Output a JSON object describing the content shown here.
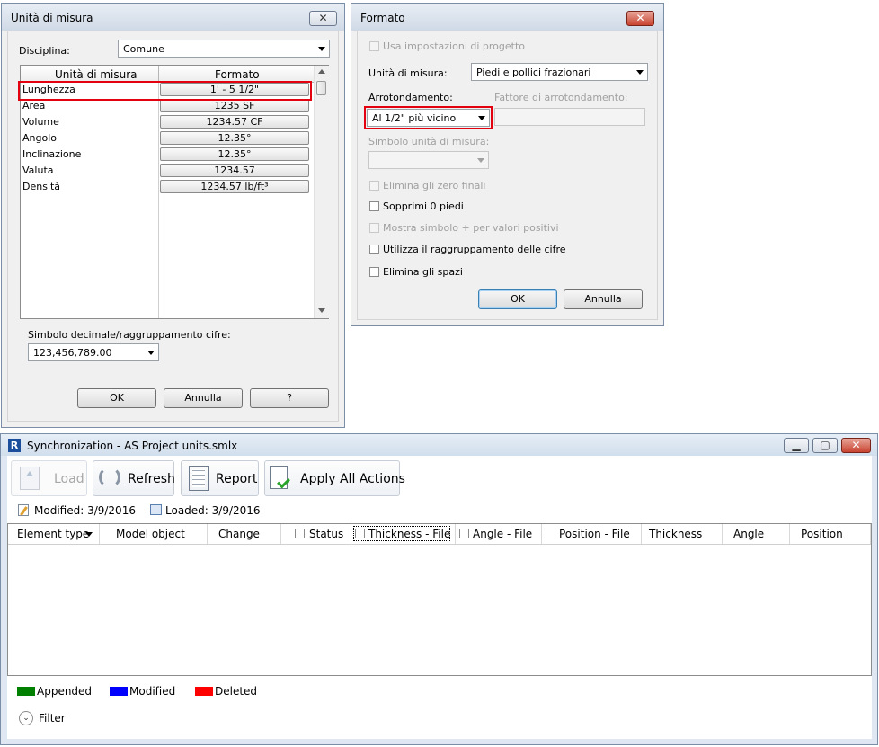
{
  "units_dialog": {
    "title": "Unità di misura",
    "discipline_label": "Disciplina:",
    "discipline_value": "Comune",
    "col_unit": "Unità di misura",
    "col_format": "Formato",
    "rows": [
      {
        "name": "Lunghezza",
        "format": "1' - 5 1/2\""
      },
      {
        "name": "Area",
        "format": "1235 SF"
      },
      {
        "name": "Volume",
        "format": "1234.57 CF"
      },
      {
        "name": "Angolo",
        "format": "12.35°"
      },
      {
        "name": "Inclinazione",
        "format": "12.35°"
      },
      {
        "name": "Valuta",
        "format": "1234.57"
      },
      {
        "name": "Densità",
        "format": "1234.57 lb/ft³"
      }
    ],
    "decimal_label": "Simbolo decimale/raggruppamento cifre:",
    "decimal_value": "123,456,789.00",
    "ok": "OK",
    "cancel": "Annulla",
    "help": "?"
  },
  "format_dialog": {
    "title": "Formato",
    "use_project": "Usa impostazioni di progetto",
    "units_label": "Unità di misura:",
    "units_value": "Piedi e pollici frazionari",
    "rounding_label": "Arrotondamento:",
    "rounding_value": "Al 1/2\" più vicino",
    "rounding_factor_label": "Fattore di arrotondamento:",
    "symbol_label": "Simbolo unità di misura:",
    "opt_trailing_zeros": "Elimina gli zero finali",
    "opt_suppress_zero_feet": "Sopprimi 0 piedi",
    "opt_plus_symbol": "Mostra simbolo + per valori positivi",
    "opt_digit_grouping": "Utilizza il raggruppamento delle cifre",
    "opt_remove_spaces": "Elimina gli spazi",
    "ok": "OK",
    "cancel": "Annulla"
  },
  "sync_window": {
    "app_icon": "R",
    "title": "Synchronization - AS Project units.smlx",
    "toolbar": {
      "load": "Load",
      "refresh": "Refresh",
      "report": "Report",
      "apply_all": "Apply All Actions"
    },
    "modified": "Modified: 3/9/2016",
    "loaded": "Loaded: 3/9/2016",
    "columns": [
      "Element type",
      "Model object",
      "Change",
      "Status",
      "Thickness - File",
      "Angle - File",
      "Position - File",
      "Thickness",
      "Angle",
      "Position"
    ],
    "legend": [
      {
        "label": "Appended",
        "color": "#008000"
      },
      {
        "label": "Modified",
        "color": "#0000ff"
      },
      {
        "label": "Deleted",
        "color": "#ff0000"
      }
    ],
    "filter": "Filter"
  }
}
